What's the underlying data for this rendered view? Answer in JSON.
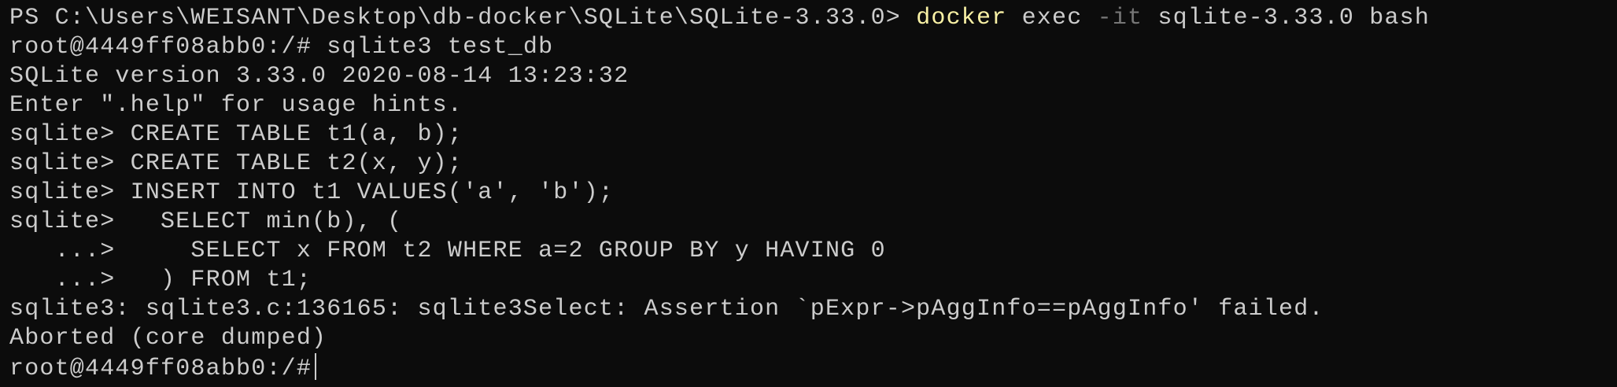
{
  "terminal": {
    "colors": {
      "background": "#0c0c0c",
      "foreground": "#cccccc",
      "command": "#f9f1a5",
      "parameter": "#767676"
    },
    "ps_prompt": "PS C:\\Users\\WEISANT\\Desktop\\db-docker\\SQLite\\SQLite-3.33.0> ",
    "ps_command": "docker",
    "ps_arg1": " exec ",
    "ps_flag": "-it",
    "ps_arg2": " sqlite-3.33.0 bash",
    "lines": [
      "root@4449ff08abb0:/# sqlite3 test_db",
      "SQLite version 3.33.0 2020-08-14 13:23:32",
      "Enter \".help\" for usage hints.",
      "sqlite> CREATE TABLE t1(a, b);",
      "sqlite> CREATE TABLE t2(x, y);",
      "sqlite> INSERT INTO t1 VALUES('a', 'b');",
      "sqlite>   SELECT min(b), (",
      "   ...>     SELECT x FROM t2 WHERE a=2 GROUP BY y HAVING 0",
      "   ...>   ) FROM t1;",
      "sqlite3: sqlite3.c:136165: sqlite3Select: Assertion `pExpr->pAggInfo==pAggInfo' failed.",
      "Aborted (core dumped)"
    ],
    "final_prompt": "root@4449ff08abb0:/#"
  }
}
